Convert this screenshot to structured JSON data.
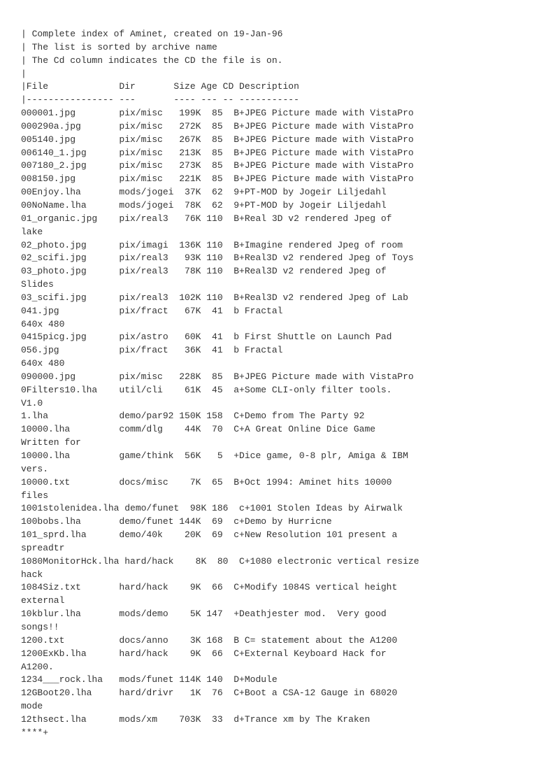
{
  "page": {
    "content": "| Complete index of Aminet, created on 19-Jan-96\n| The list is sorted by archive name\n| The Cd column indicates the CD the file is on.\n|\n|File             Dir       Size Age CD Description\n|---------------- ---       ---- --- -- -----------\n000001.jpg        pix/misc   199K  85  B+JPEG Picture made with VistaPro\n000290a.jpg       pix/misc   272K  85  B+JPEG Picture made with VistaPro\n005140.jpg        pix/misc   267K  85  B+JPEG Picture made with VistaPro\n006140_1.jpg      pix/misc   213K  85  B+JPEG Picture made with VistaPro\n007180_2.jpg      pix/misc   273K  85  B+JPEG Picture made with VistaPro\n008150.jpg        pix/misc   221K  85  B+JPEG Picture made with VistaPro\n00Enjoy.lha       mods/jogei  37K  62  9+PT-MOD by Jogeir Liljedahl\n00NoName.lha      mods/jogei  78K  62  9+PT-MOD by Jogeir Liljedahl\n01_organic.jpg    pix/real3   76K 110  B+Real 3D v2 rendered Jpeg of\nlake\n02_photo.jpg      pix/imagi  136K 110  B+Imagine rendered Jpeg of room\n02_scifi.jpg      pix/real3   93K 110  B+Real3D v2 rendered Jpeg of Toys\n03_photo.jpg      pix/real3   78K 110  B+Real3D v2 rendered Jpeg of\nSlides\n03_scifi.jpg      pix/real3  102K 110  B+Real3D v2 rendered Jpeg of Lab\n041.jpg           pix/fract   67K  41  b Fractal\n640x 480\n0415picg.jpg      pix/astro   60K  41  b First Shuttle on Launch Pad\n056.jpg           pix/fract   36K  41  b Fractal\n640x 480\n090000.jpg        pix/misc   228K  85  B+JPEG Picture made with VistaPro\n0Filters10.lha    util/cli    61K  45  a+Some CLI-only filter tools.\nV1.0\n1.lha             demo/par92 150K 158  C+Demo from The Party 92\n10000.lha         comm/dlg    44K  70  C+A Great Online Dice Game\nWritten for\n10000.lha         game/think  56K   5  +Dice game, 0-8 plr, Amiga & IBM\nvers.\n10000.txt         docs/misc    7K  65  B+Oct 1994: Aminet hits 10000\nfiles\n1001stolenidea.lha demo/funet  98K 186  c+1001 Stolen Ideas by Airwalk\n100bobs.lha       demo/funet 144K  69  c+Demo by Hurricne\n101_sprd.lha      demo/40k    20K  69  c+New Resolution 101 present a\nspreadtr\n1080MonitorHck.lha hard/hack    8K  80  C+1080 electronic vertical resize\nhack\n1084Siz.txt       hard/hack    9K  66  C+Modify 1084S vertical height\nexternal\n10kblur.lha       mods/demo    5K 147  +Deathjester mod.  Very good\nsongs!!\n1200.txt          docs/anno    3K 168  B C= statement about the A1200\n1200ExKb.lha      hard/hack    9K  66  C+External Keyboard Hack for\nA1200.\n1234___rock.lha   mods/funet 114K 140  D+Module\n12GBoot20.lha     hard/drivr   1K  76  C+Boot a CSA-12 Gauge in 68020\nmode\n12thsect.lha      mods/xm    703K  33  d+Trance xm by The Kraken\n****+"
  }
}
